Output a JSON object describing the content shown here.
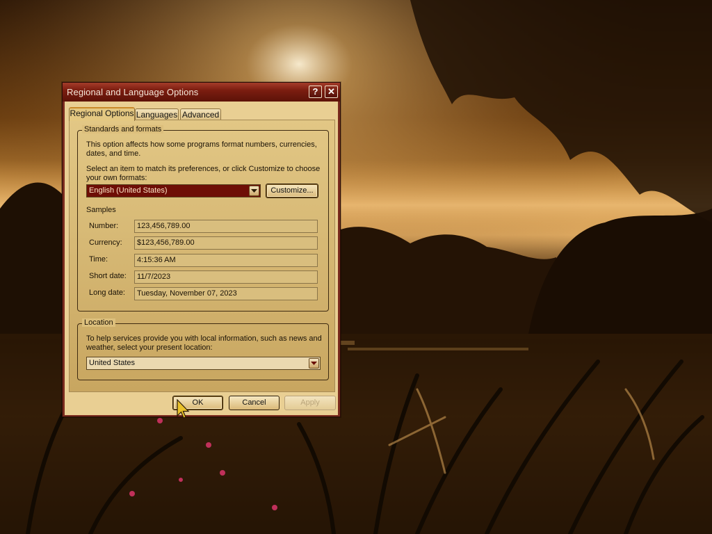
{
  "dialog": {
    "title": "Regional and Language Options",
    "help_button": "?",
    "close_button": "✕",
    "tabs": [
      {
        "label": "Regional Options",
        "active": true
      },
      {
        "label": "Languages",
        "active": false
      },
      {
        "label": "Advanced",
        "active": false
      }
    ],
    "standards": {
      "group_title": "Standards and formats",
      "desc_line1": "This option affects how some programs format numbers, currencies,",
      "desc_line2": "dates, and time.",
      "select_line1": "Select an item to match its preferences, or click Customize to choose",
      "select_line2": "your own formats:",
      "format_selected": "English (United States)",
      "customize_button": "Customize...",
      "samples_label": "Samples",
      "samples": [
        {
          "label": "Number:",
          "value": "123,456,789.00"
        },
        {
          "label": "Currency:",
          "value": "$123,456,789.00"
        },
        {
          "label": "Time:",
          "value": "4:15:36 AM"
        },
        {
          "label": "Short date:",
          "value": "11/7/2023"
        },
        {
          "label": "Long date:",
          "value": "Tuesday, November 07, 2023"
        }
      ]
    },
    "location": {
      "group_title": "Location",
      "desc_line1": "To help services provide you with local information, such as news and",
      "desc_line2": "weather, select your present location:",
      "selected": "United States"
    },
    "buttons": {
      "ok": "OK",
      "cancel": "Cancel",
      "apply": "Apply"
    }
  },
  "colors": {
    "title_bar": "#7b1d10",
    "dialog_face": "#e9cf93",
    "selection_highlight": "#6e0e06",
    "wallpaper_tone": "sepia"
  }
}
